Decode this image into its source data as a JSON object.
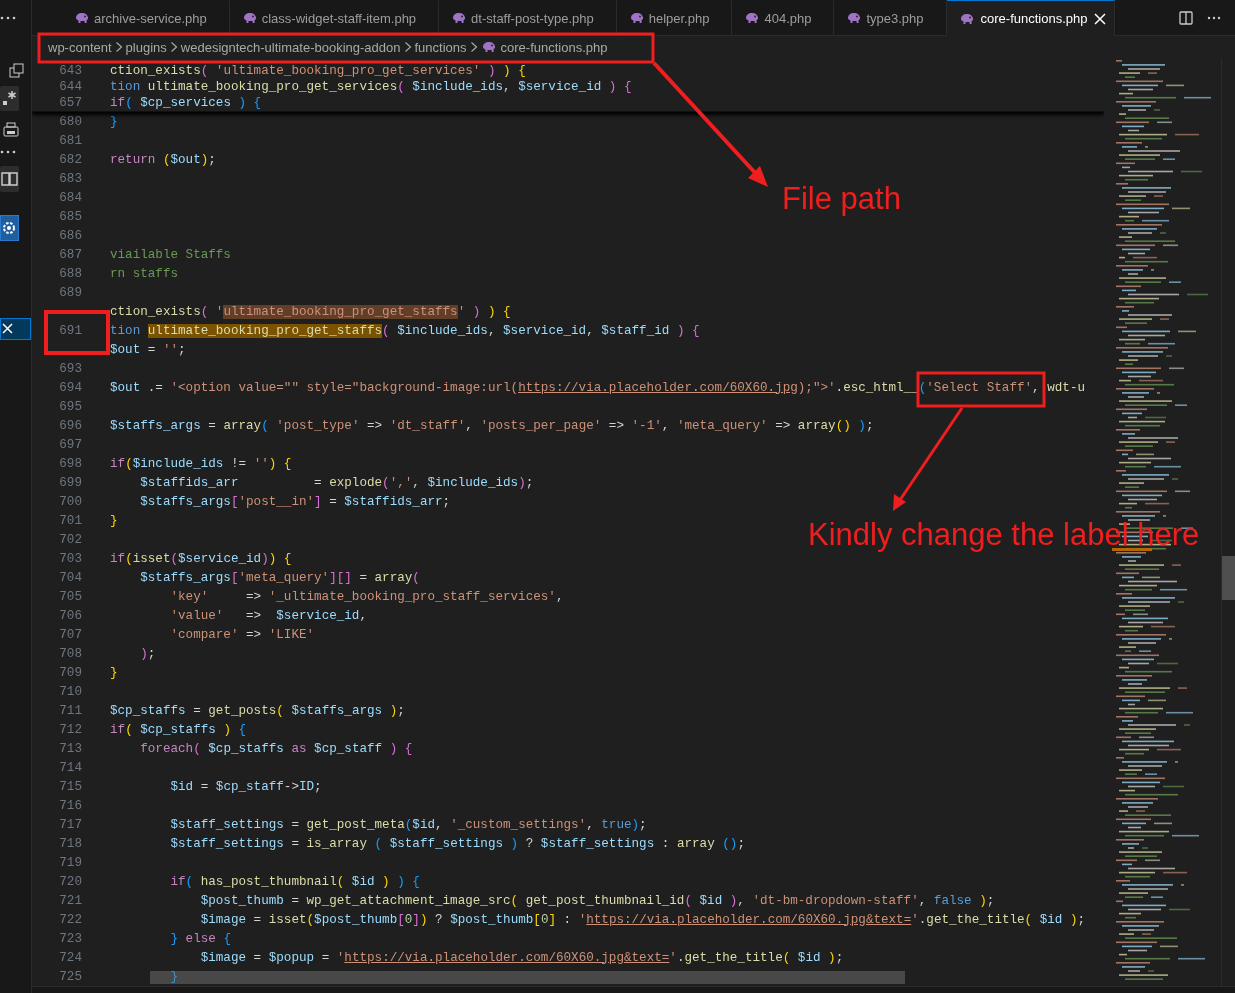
{
  "tabs": [
    {
      "label": "archive-service.php",
      "selected": false
    },
    {
      "label": "class-widget-staff-item.php",
      "selected": false
    },
    {
      "label": "dt-staff-post-type.php",
      "selected": false
    },
    {
      "label": "helper.php",
      "selected": false
    },
    {
      "label": "404.php",
      "selected": false
    },
    {
      "label": "type3.php",
      "selected": false
    },
    {
      "label": "core-functions.php",
      "selected": true
    }
  ],
  "breadcrumb": {
    "folders": [
      "wp-content",
      "plugins",
      "wedesigntech-ultimate-booking-addon",
      "functions"
    ],
    "file": "core-functions.php"
  },
  "editor": {
    "sticky_lines": [
      {
        "n": "643",
        "tokens": [
          {
            "kind": "fn",
            "text": "ction_exists"
          },
          {
            "kind": "p",
            "text": "("
          },
          {
            "kind": "str",
            "text": " 'ultimate_booking_pro_get_services'"
          },
          {
            "kind": "p",
            "text": " )"
          },
          {
            "kind": "y",
            "text": " )"
          },
          {
            "kind": "y",
            "text": " {"
          }
        ]
      },
      {
        "n": "644",
        "tokens": [
          {
            "kind": "st",
            "text": "tion"
          },
          {
            "kind": "fn",
            "text": " ultimate_booking_pro_get_services"
          },
          {
            "kind": "p",
            "text": "("
          },
          {
            "kind": "var",
            "text": " $include_ids"
          },
          {
            "kind": "pl",
            "text": ", "
          },
          {
            "kind": "var",
            "text": "$service_id"
          },
          {
            "kind": "p",
            "text": " )"
          },
          {
            "kind": "p",
            "text": " {"
          }
        ]
      },
      {
        "n": "657",
        "tokens": [
          {
            "kind": "kw",
            "text": "if"
          },
          {
            "kind": "b",
            "text": "("
          },
          {
            "kind": "var",
            "text": " $cp_services"
          },
          {
            "kind": "b",
            "text": " )"
          },
          {
            "kind": "b",
            "text": " {"
          }
        ]
      }
    ],
    "lines": [
      {
        "n": "680",
        "tokens": [
          {
            "kind": "b",
            "text": "}"
          }
        ]
      },
      {
        "n": "681"
      },
      {
        "n": "682",
        "tokens": [
          {
            "kind": "kw",
            "text": "return"
          },
          {
            "kind": "y",
            "text": " ("
          },
          {
            "kind": "var",
            "text": "$out"
          },
          {
            "kind": "y",
            "text": ")"
          },
          {
            "kind": "pl",
            "text": ";"
          }
        ]
      },
      {
        "n": "683"
      },
      {
        "n": "684"
      },
      {
        "n": "685"
      },
      {
        "n": "686"
      },
      {
        "n": "687",
        "tokens": [
          {
            "kind": "cm",
            "text": "viailable Staffs"
          }
        ]
      },
      {
        "n": "688",
        "tokens": [
          {
            "kind": "cm",
            "text": "rn staffs"
          }
        ]
      },
      {
        "n": "689"
      },
      {
        "tokens": [
          {
            "kind": "fn",
            "text": "ction_exists"
          },
          {
            "kind": "p",
            "text": "("
          },
          {
            "kind": "str",
            "text": " '"
          },
          {
            "kind": "match",
            "text": "ultimate_booking_pro_get_staffs"
          },
          {
            "kind": "str",
            "text": "'"
          },
          {
            "kind": "p",
            "text": " )"
          },
          {
            "kind": "y",
            "text": " )"
          },
          {
            "kind": "y",
            "text": " {"
          }
        ]
      },
      {
        "n": "691",
        "tokens": [
          {
            "kind": "st",
            "text": "tion "
          },
          {
            "kind": "sel",
            "text": "ultimate_booking_pro_get_staffs"
          },
          {
            "kind": "p",
            "text": "("
          },
          {
            "kind": "var",
            "text": " $include_ids"
          },
          {
            "kind": "pl",
            "text": ", "
          },
          {
            "kind": "var",
            "text": "$service_id"
          },
          {
            "kind": "pl",
            "text": ", "
          },
          {
            "kind": "var",
            "text": "$staff_id"
          },
          {
            "kind": "p",
            "text": " )"
          },
          {
            "kind": "p",
            "text": " {"
          }
        ]
      },
      {
        "tokens": [
          {
            "kind": "var",
            "text": "$out"
          },
          {
            "kind": "pl",
            "text": " = "
          },
          {
            "kind": "str",
            "text": "''"
          },
          {
            "kind": "pl",
            "text": ";"
          }
        ]
      },
      {
        "n": "693"
      },
      {
        "n": "694",
        "tokens": [
          {
            "kind": "var",
            "text": "$out"
          },
          {
            "kind": "pl",
            "text": " .= "
          },
          {
            "kind": "str",
            "text": "'<option value=\"\" style=\"background-image:url("
          },
          {
            "kind": "url",
            "text": "https://via.placeholder.com/60X60.jpg"
          },
          {
            "kind": "str",
            "text": ");\">'"
          },
          {
            "kind": "pl",
            "text": "."
          },
          {
            "kind": "fn",
            "text": "esc_html__"
          },
          {
            "kind": "b",
            "text": "("
          },
          {
            "kind": "str",
            "text": "'Select Staff'"
          },
          {
            "kind": "pl",
            "text": ", "
          },
          {
            "kind": "fn",
            "text": "wdt-u"
          }
        ]
      },
      {
        "n": "695"
      },
      {
        "n": "696",
        "tokens": [
          {
            "kind": "var",
            "text": "$staffs_args"
          },
          {
            "kind": "pl",
            "text": " = "
          },
          {
            "kind": "fn",
            "text": "array"
          },
          {
            "kind": "b",
            "text": "("
          },
          {
            "kind": "str",
            "text": " 'post_type'"
          },
          {
            "kind": "pl",
            "text": " => "
          },
          {
            "kind": "str",
            "text": "'dt_staff'"
          },
          {
            "kind": "pl",
            "text": ", "
          },
          {
            "kind": "str",
            "text": "'posts_per_page'"
          },
          {
            "kind": "pl",
            "text": " => "
          },
          {
            "kind": "str",
            "text": "'-1'"
          },
          {
            "kind": "pl",
            "text": ", "
          },
          {
            "kind": "str",
            "text": "'meta_query'"
          },
          {
            "kind": "pl",
            "text": " => "
          },
          {
            "kind": "fn",
            "text": "array"
          },
          {
            "kind": "y",
            "text": "()"
          },
          {
            "kind": "b",
            "text": " )"
          },
          {
            "kind": "pl",
            "text": ";"
          }
        ]
      },
      {
        "n": "697"
      },
      {
        "n": "698",
        "tokens": [
          {
            "kind": "kw",
            "text": "if"
          },
          {
            "kind": "y",
            "text": "("
          },
          {
            "kind": "var",
            "text": "$include_ids"
          },
          {
            "kind": "pl",
            "text": " != "
          },
          {
            "kind": "str",
            "text": "''"
          },
          {
            "kind": "y",
            "text": ")"
          },
          {
            "kind": "y",
            "text": " {"
          }
        ]
      },
      {
        "n": "699",
        "tokens": [
          {
            "kind": "var",
            "text": "    $staffids_arr"
          },
          {
            "kind": "pl",
            "text": "          = "
          },
          {
            "kind": "fn",
            "text": "explode"
          },
          {
            "kind": "p",
            "text": "("
          },
          {
            "kind": "str",
            "text": "','"
          },
          {
            "kind": "pl",
            "text": ", "
          },
          {
            "kind": "var",
            "text": "$include_ids"
          },
          {
            "kind": "p",
            "text": ")"
          },
          {
            "kind": "pl",
            "text": ";"
          }
        ]
      },
      {
        "n": "700",
        "tokens": [
          {
            "kind": "var",
            "text": "    $staffs_args"
          },
          {
            "kind": "p",
            "text": "["
          },
          {
            "kind": "str",
            "text": "'post__in'"
          },
          {
            "kind": "p",
            "text": "]"
          },
          {
            "kind": "pl",
            "text": " = "
          },
          {
            "kind": "var",
            "text": "$staffids_arr"
          },
          {
            "kind": "pl",
            "text": ";"
          }
        ]
      },
      {
        "n": "701",
        "tokens": [
          {
            "kind": "y",
            "text": "}"
          }
        ]
      },
      {
        "n": "702"
      },
      {
        "n": "703",
        "tokens": [
          {
            "kind": "kw",
            "text": "if"
          },
          {
            "kind": "y",
            "text": "("
          },
          {
            "kind": "fn",
            "text": "isset"
          },
          {
            "kind": "p",
            "text": "("
          },
          {
            "kind": "var",
            "text": "$service_id"
          },
          {
            "kind": "p",
            "text": ")"
          },
          {
            "kind": "y",
            "text": ")"
          },
          {
            "kind": "y",
            "text": " {"
          }
        ]
      },
      {
        "n": "704",
        "tokens": [
          {
            "kind": "var",
            "text": "    $staffs_args"
          },
          {
            "kind": "p",
            "text": "["
          },
          {
            "kind": "str",
            "text": "'meta_query'"
          },
          {
            "kind": "p",
            "text": "][]"
          },
          {
            "kind": "pl",
            "text": " = "
          },
          {
            "kind": "fn",
            "text": "array"
          },
          {
            "kind": "p",
            "text": "("
          }
        ]
      },
      {
        "n": "705",
        "tokens": [
          {
            "kind": "str",
            "text": "        'key'"
          },
          {
            "kind": "pl",
            "text": "     => "
          },
          {
            "kind": "str",
            "text": "'_ultimate_booking_pro_staff_services'"
          },
          {
            "kind": "pl",
            "text": ","
          }
        ]
      },
      {
        "n": "706",
        "tokens": [
          {
            "kind": "str",
            "text": "        'value'"
          },
          {
            "kind": "pl",
            "text": "   =>  "
          },
          {
            "kind": "var",
            "text": "$service_id"
          },
          {
            "kind": "pl",
            "text": ","
          }
        ]
      },
      {
        "n": "707",
        "tokens": [
          {
            "kind": "str",
            "text": "        'compare'"
          },
          {
            "kind": "pl",
            "text": " => "
          },
          {
            "kind": "str",
            "text": "'LIKE'"
          }
        ]
      },
      {
        "n": "708",
        "tokens": [
          {
            "kind": "p",
            "text": "    )"
          },
          {
            "kind": "pl",
            "text": ";"
          }
        ]
      },
      {
        "n": "709",
        "tokens": [
          {
            "kind": "y",
            "text": "}"
          }
        ]
      },
      {
        "n": "710"
      },
      {
        "n": "711",
        "tokens": [
          {
            "kind": "var",
            "text": "$cp_staffs"
          },
          {
            "kind": "pl",
            "text": " = "
          },
          {
            "kind": "fn",
            "text": "get_posts"
          },
          {
            "kind": "y",
            "text": "("
          },
          {
            "kind": "var",
            "text": " $staffs_args"
          },
          {
            "kind": "y",
            "text": " )"
          },
          {
            "kind": "pl",
            "text": ";"
          }
        ]
      },
      {
        "n": "712",
        "tokens": [
          {
            "kind": "kw",
            "text": "if"
          },
          {
            "kind": "y",
            "text": "("
          },
          {
            "kind": "var",
            "text": " $cp_staffs"
          },
          {
            "kind": "y",
            "text": " )"
          },
          {
            "kind": "b",
            "text": " {"
          }
        ]
      },
      {
        "n": "713",
        "tokens": [
          {
            "kind": "kw",
            "text": "    foreach"
          },
          {
            "kind": "p",
            "text": "("
          },
          {
            "kind": "var",
            "text": " $cp_staffs"
          },
          {
            "kind": "kw",
            "text": " as"
          },
          {
            "kind": "var",
            "text": " $cp_staff"
          },
          {
            "kind": "p",
            "text": " )"
          },
          {
            "kind": "p",
            "text": " {"
          }
        ]
      },
      {
        "n": "714"
      },
      {
        "n": "715",
        "tokens": [
          {
            "kind": "var",
            "text": "        $id"
          },
          {
            "kind": "pl",
            "text": " = "
          },
          {
            "kind": "var",
            "text": "$cp_staff"
          },
          {
            "kind": "pl",
            "text": "->"
          },
          {
            "kind": "var",
            "text": "ID"
          },
          {
            "kind": "pl",
            "text": ";"
          }
        ]
      },
      {
        "n": "716"
      },
      {
        "n": "717",
        "tokens": [
          {
            "kind": "var",
            "text": "        $staff_settings"
          },
          {
            "kind": "pl",
            "text": " = "
          },
          {
            "kind": "fn",
            "text": "get_post_meta"
          },
          {
            "kind": "b",
            "text": "("
          },
          {
            "kind": "var",
            "text": "$id"
          },
          {
            "kind": "pl",
            "text": ", "
          },
          {
            "kind": "str",
            "text": "'_custom_settings'"
          },
          {
            "kind": "pl",
            "text": ", "
          },
          {
            "kind": "st",
            "text": "true"
          },
          {
            "kind": "b",
            "text": ")"
          },
          {
            "kind": "pl",
            "text": ";"
          }
        ]
      },
      {
        "n": "718",
        "tokens": [
          {
            "kind": "var",
            "text": "        $staff_settings"
          },
          {
            "kind": "pl",
            "text": " = "
          },
          {
            "kind": "fn",
            "text": "is_array"
          },
          {
            "kind": "b",
            "text": " ("
          },
          {
            "kind": "var",
            "text": " $staff_settings"
          },
          {
            "kind": "b",
            "text": " )"
          },
          {
            "kind": "pl",
            "text": " ? "
          },
          {
            "kind": "var",
            "text": "$staff_settings"
          },
          {
            "kind": "pl",
            "text": " : "
          },
          {
            "kind": "fn",
            "text": "array"
          },
          {
            "kind": "b",
            "text": " ()"
          },
          {
            "kind": "pl",
            "text": ";"
          }
        ]
      },
      {
        "n": "719"
      },
      {
        "n": "720",
        "tokens": [
          {
            "kind": "kw",
            "text": "        if"
          },
          {
            "kind": "b",
            "text": "("
          },
          {
            "kind": "fn",
            "text": " has_post_thumbnail"
          },
          {
            "kind": "y",
            "text": "("
          },
          {
            "kind": "var",
            "text": " $id"
          },
          {
            "kind": "y",
            "text": " )"
          },
          {
            "kind": "b",
            "text": " )"
          },
          {
            "kind": "b",
            "text": " {"
          }
        ]
      },
      {
        "n": "721",
        "tokens": [
          {
            "kind": "var",
            "text": "            $post_thumb"
          },
          {
            "kind": "pl",
            "text": " = "
          },
          {
            "kind": "fn",
            "text": "wp_get_attachment_image_src"
          },
          {
            "kind": "y",
            "text": "("
          },
          {
            "kind": "fn",
            "text": " get_post_thumbnail_id"
          },
          {
            "kind": "p",
            "text": "("
          },
          {
            "kind": "var",
            "text": " $id"
          },
          {
            "kind": "p",
            "text": " )"
          },
          {
            "kind": "pl",
            "text": ", "
          },
          {
            "kind": "str",
            "text": "'dt-bm-dropdown-staff'"
          },
          {
            "kind": "pl",
            "text": ", "
          },
          {
            "kind": "st",
            "text": "false"
          },
          {
            "kind": "y",
            "text": " )"
          },
          {
            "kind": "pl",
            "text": ";"
          }
        ]
      },
      {
        "n": "722",
        "tokens": [
          {
            "kind": "var",
            "text": "            $image"
          },
          {
            "kind": "pl",
            "text": " = "
          },
          {
            "kind": "fn",
            "text": "isset"
          },
          {
            "kind": "y",
            "text": "("
          },
          {
            "kind": "var",
            "text": "$post_thumb"
          },
          {
            "kind": "p",
            "text": "["
          },
          {
            "kind": "num",
            "text": "0"
          },
          {
            "kind": "p",
            "text": "]"
          },
          {
            "kind": "y",
            "text": ")"
          },
          {
            "kind": "pl",
            "text": " ? "
          },
          {
            "kind": "var",
            "text": "$post_thumb"
          },
          {
            "kind": "y",
            "text": "["
          },
          {
            "kind": "num",
            "text": "0"
          },
          {
            "kind": "y",
            "text": "]"
          },
          {
            "kind": "pl",
            "text": " : "
          },
          {
            "kind": "str",
            "text": "'"
          },
          {
            "kind": "url",
            "text": "https://via.placeholder.com/60X60.jpg&text="
          },
          {
            "kind": "str",
            "text": "'"
          },
          {
            "kind": "pl",
            "text": "."
          },
          {
            "kind": "fn",
            "text": "get_the_title"
          },
          {
            "kind": "y",
            "text": "("
          },
          {
            "kind": "var",
            "text": " $id"
          },
          {
            "kind": "y",
            "text": " )"
          },
          {
            "kind": "pl",
            "text": ";"
          }
        ]
      },
      {
        "n": "723",
        "tokens": [
          {
            "kind": "b",
            "text": "        }"
          },
          {
            "kind": "kw",
            "text": " else"
          },
          {
            "kind": "b",
            "text": " {"
          }
        ]
      },
      {
        "n": "724",
        "tokens": [
          {
            "kind": "var",
            "text": "            $image"
          },
          {
            "kind": "pl",
            "text": " = "
          },
          {
            "kind": "var",
            "text": "$popup"
          },
          {
            "kind": "pl",
            "text": " = "
          },
          {
            "kind": "str",
            "text": "'"
          },
          {
            "kind": "url",
            "text": "https://via.placeholder.com/60X60.jpg&text="
          },
          {
            "kind": "str",
            "text": "'"
          },
          {
            "kind": "pl",
            "text": "."
          },
          {
            "kind": "fn",
            "text": "get_the_title"
          },
          {
            "kind": "y",
            "text": "("
          },
          {
            "kind": "var",
            "text": " $id"
          },
          {
            "kind": "y",
            "text": " )"
          },
          {
            "kind": "pl",
            "text": ";"
          }
        ]
      },
      {
        "n": "725",
        "tokens": [
          {
            "kind": "b",
            "text": "        }"
          }
        ]
      }
    ]
  },
  "annotations": [
    {
      "kind": "file-path",
      "text": "File path"
    },
    {
      "kind": "label",
      "text": "Kindly change the label here"
    }
  ]
}
